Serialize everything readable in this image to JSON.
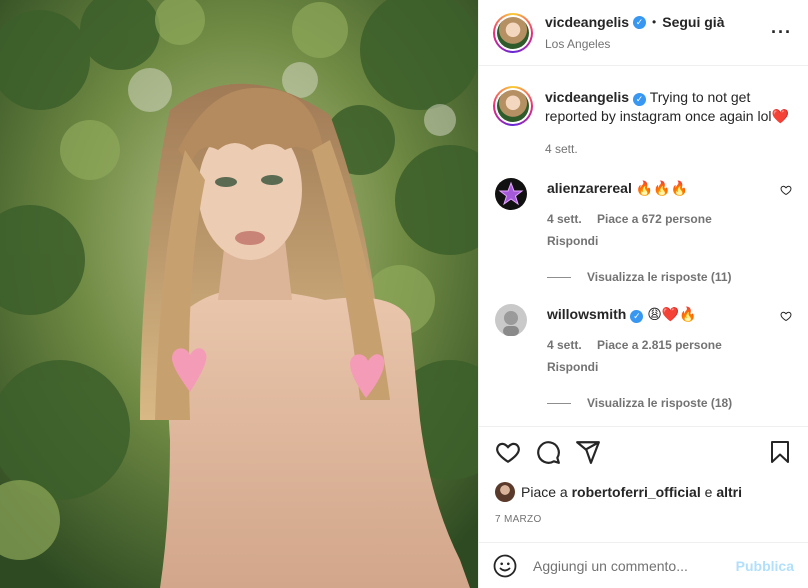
{
  "post": {
    "username": "vicdeangelis",
    "verified_icon": "verified-badge-icon",
    "separator": "•",
    "follow_label": "Segui già",
    "location": "Los Angeles",
    "more_icon": "more-options-icon",
    "more_glyph": "···"
  },
  "caption": {
    "username": "vicdeangelis",
    "text": "Trying to not get reported by instagram once again lol",
    "emoji": "❤️",
    "time": "4 sett."
  },
  "comments": [
    {
      "username": "alienzarereal",
      "text": "🔥🔥🔥",
      "time": "4 sett.",
      "likes": "Piace a 672 persone",
      "reply_label": "Rispondi",
      "view_replies": "Visualizza le risposte (11)",
      "avatar_color": "#111111"
    },
    {
      "username": "willowsmith",
      "verified": true,
      "text": "😩❤️🔥",
      "time": "4 sett.",
      "likes": "Piace a 2.815 persone",
      "reply_label": "Rispondi",
      "view_replies": "Visualizza le risposte (18)",
      "avatar_color": "#c9c9c9"
    }
  ],
  "actions": {
    "icons": [
      "heart-icon",
      "comment-icon",
      "share-icon",
      "bookmark-icon"
    ],
    "likes_prefix": "Piace a",
    "likes_user": "robertoferri_official",
    "likes_suffix": "e",
    "likes_others": "altri",
    "date": "7 MARZO"
  },
  "add_comment": {
    "emoji_icon": "emoji-icon",
    "placeholder": "Aggiungi un commento...",
    "publish_label": "Pubblica"
  },
  "colors": {
    "accent_blue": "#3897f0",
    "publish_disabled": "#b2dffc",
    "secondary_text": "#737373",
    "heart_sticker": "#f49bb7"
  }
}
